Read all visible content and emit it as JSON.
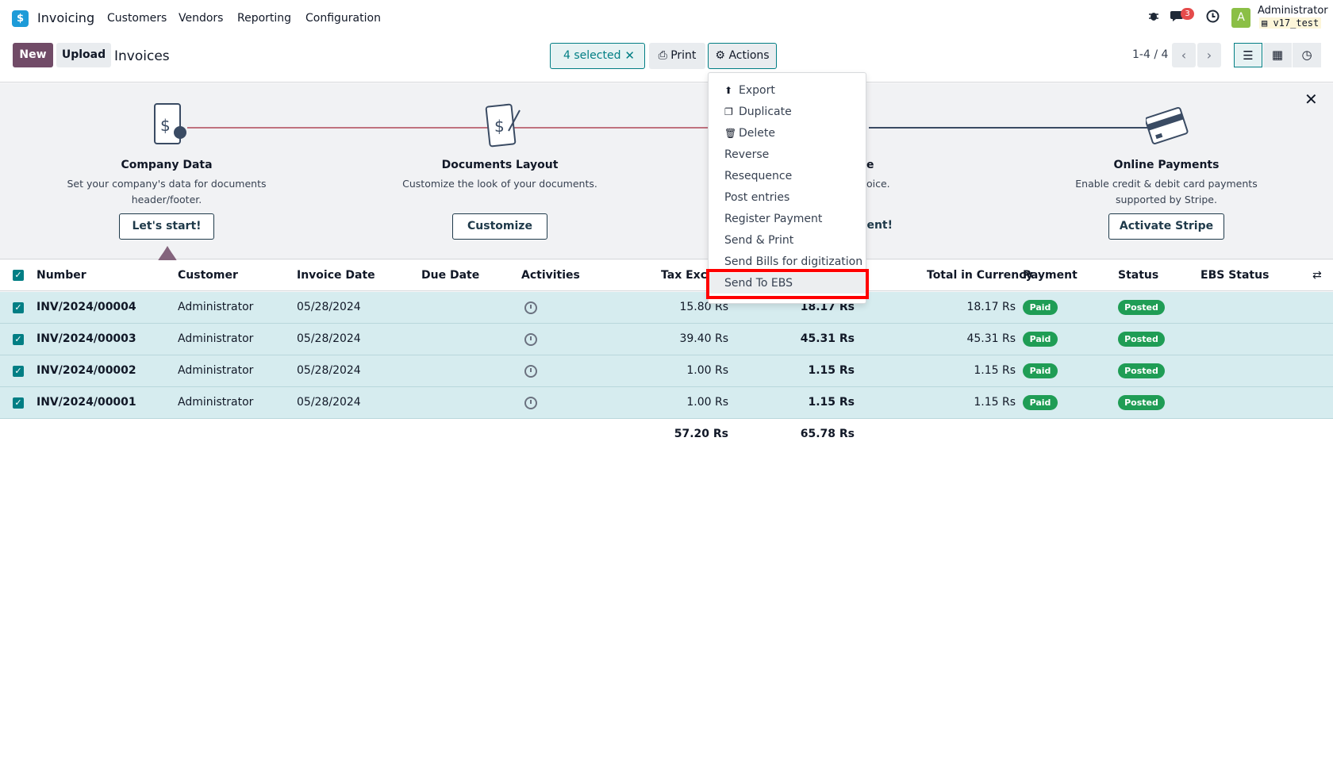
{
  "navbar": {
    "app_logo": "$",
    "app_name": "Invoicing",
    "menu": [
      "Customers",
      "Vendors",
      "Reporting",
      "Configuration"
    ],
    "message_count": "3",
    "avatar_letter": "A",
    "user_name": "Administrator",
    "db_name": "v17_test"
  },
  "control": {
    "new_label": "New",
    "upload_label": "Upload",
    "breadcrumb": "Invoices",
    "selected_label": "4 selected",
    "print_label": "Print",
    "actions_label": "Actions",
    "pager": "1-4 / 4"
  },
  "banner": {
    "steps": [
      {
        "title": "Company Data",
        "desc_line1": "Set your company's data for documents",
        "desc_line2": "header/footer.",
        "button": "Let's start!"
      },
      {
        "title": "Documents Layout",
        "desc_line1": "Customize the look of your documents.",
        "desc_line2": "",
        "button": "Customize"
      },
      {
        "title": "e",
        "desc_line1": "oice.",
        "desc_line2": "",
        "button": "sent!"
      },
      {
        "title": "Online Payments",
        "desc_line1": "Enable credit & debit card payments",
        "desc_line2": "supported by Stripe.",
        "button": "Activate Stripe"
      }
    ]
  },
  "table": {
    "headers": {
      "number": "Number",
      "customer": "Customer",
      "invoice_date": "Invoice Date",
      "due_date": "Due Date",
      "activities": "Activities",
      "tax_excluded": "Tax Exclu",
      "total_currency": "Total in Currency",
      "payment": "Payment",
      "status": "Status",
      "ebs_status": "EBS Status"
    },
    "rows": [
      {
        "number": "INV/2024/00004",
        "customer": "Administrator",
        "date": "05/28/2024",
        "tax_excl": "15.80 Rs",
        "total": "18.17 Rs",
        "total_currency": "18.17 Rs",
        "payment": "Paid",
        "status": "Posted"
      },
      {
        "number": "INV/2024/00003",
        "customer": "Administrator",
        "date": "05/28/2024",
        "tax_excl": "39.40 Rs",
        "total": "45.31 Rs",
        "total_currency": "45.31 Rs",
        "payment": "Paid",
        "status": "Posted"
      },
      {
        "number": "INV/2024/00002",
        "customer": "Administrator",
        "date": "05/28/2024",
        "tax_excl": "1.00 Rs",
        "total": "1.15 Rs",
        "total_currency": "1.15 Rs",
        "payment": "Paid",
        "status": "Posted"
      },
      {
        "number": "INV/2024/00001",
        "customer": "Administrator",
        "date": "05/28/2024",
        "tax_excl": "1.00 Rs",
        "total": "1.15 Rs",
        "total_currency": "1.15 Rs",
        "payment": "Paid",
        "status": "Posted"
      }
    ],
    "totals": {
      "tax_excl": "57.20 Rs",
      "total": "65.78 Rs"
    }
  },
  "actions_menu": {
    "items": [
      "Export",
      "Duplicate",
      "Delete",
      "Reverse",
      "Resequence",
      "Post entries",
      "Register Payment",
      "Send & Print",
      "Send Bills for digitization",
      "Send To EBS"
    ]
  },
  "colors": {
    "brand": "#714b67",
    "accent": "#017e84",
    "paid": "#1f9d55",
    "highlight": "#ff0000"
  }
}
